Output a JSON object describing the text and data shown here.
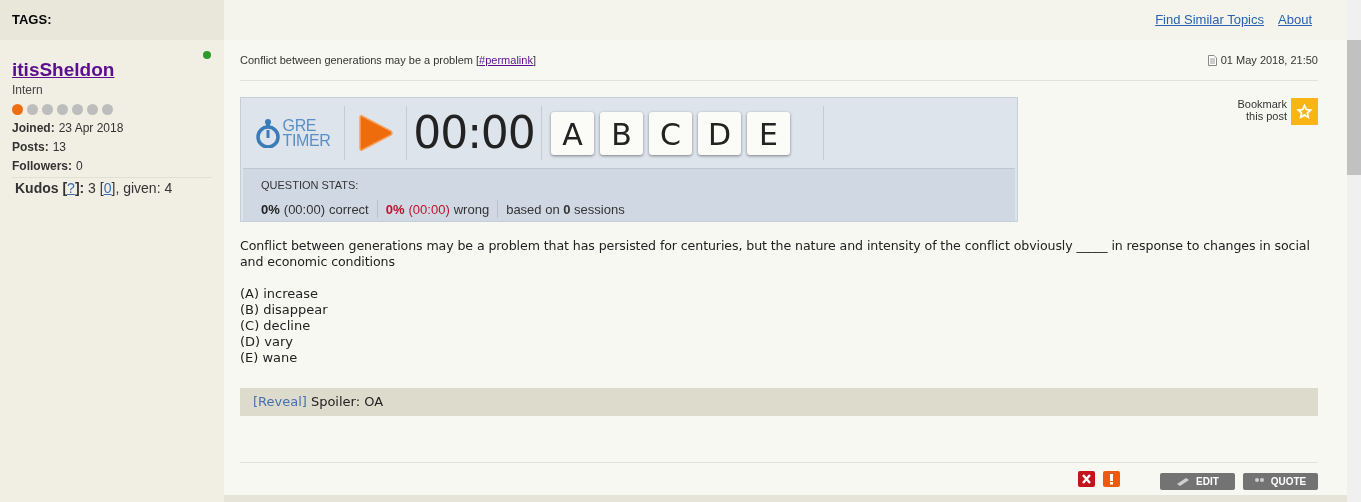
{
  "tags_label": "TAGS:",
  "top_links": [
    "Find Similar Topics",
    "About"
  ],
  "author": {
    "name": "itisSheldon",
    "rank": "Intern",
    "online": true,
    "rank_dots": [
      {
        "filled": true
      },
      {
        "filled": false
      },
      {
        "filled": false
      },
      {
        "filled": false
      },
      {
        "filled": false
      },
      {
        "filled": false
      },
      {
        "filled": false
      }
    ],
    "stats": [
      {
        "label": "Joined:",
        "value": "23 Apr 2018"
      },
      {
        "label": "Posts:",
        "value": "13"
      },
      {
        "label": "Followers:",
        "value": "0"
      }
    ],
    "kudos": [
      {
        "kind": "bold",
        "text": "Kudos ["
      },
      {
        "kind": "link",
        "text": "?"
      },
      {
        "kind": "bold",
        "text": "]:"
      },
      {
        "kind": "plain",
        "text": " 3 ["
      },
      {
        "kind": "link",
        "text": "0"
      },
      {
        "kind": "plain",
        "text": "], given: 4"
      }
    ]
  },
  "post": {
    "title": [
      {
        "kind": "plain",
        "text": "Conflict between generations may be a problem ["
      },
      {
        "kind": "link",
        "text": "#permalink"
      },
      {
        "kind": "plain",
        "text": "]"
      }
    ],
    "date": "01 May 2018, 21:50",
    "bookmark": "Bookmark this post",
    "timer": {
      "logo_top": "GRE",
      "logo_bottom": "TIMER",
      "time": "00:00",
      "choices": [
        {
          "letter": "A",
          "selected": false
        },
        {
          "letter": "B",
          "selected": false
        },
        {
          "letter": "C",
          "selected": false
        },
        {
          "letter": "D",
          "selected": false
        },
        {
          "letter": "E",
          "selected": false
        }
      ],
      "stats_title": "QUESTION STATS:",
      "correct": {
        "pct": "0%",
        "time": "(00:00)",
        "label": "correct"
      },
      "wrong": {
        "pct": "0%",
        "time": "(00:00)",
        "label": "wrong"
      },
      "sessions": "based on **0** sessions"
    },
    "question": "Conflict between generations may be a problem that has persisted for centuries, but the nature and intensity of the conflict obviously _____ in response to changes in social and economic conditions",
    "options": [
      "(A) increase",
      "(B) disappear",
      "(C) decline",
      "(D) vary",
      "(E) wane"
    ],
    "spoiler": {
      "link": "[Reveal]",
      "text": "Spoiler: OA"
    },
    "actions": [
      "EDIT",
      "QUOTE"
    ]
  }
}
